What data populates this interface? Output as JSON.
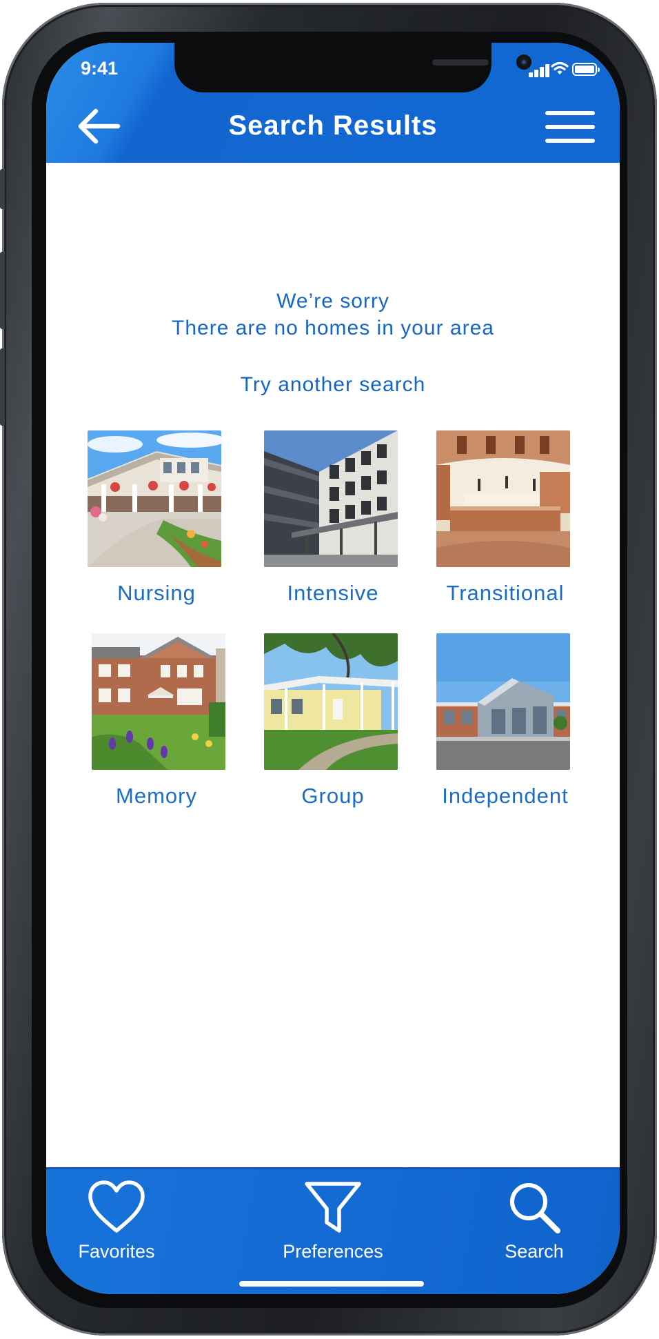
{
  "status": {
    "time": "9:41"
  },
  "header": {
    "title": "Search Results"
  },
  "message": {
    "sorry": "We’re sorry",
    "none": "There are no homes in your area",
    "try": "Try another search"
  },
  "categories": [
    {
      "label": "Nursing",
      "image": "nursing-home-photo"
    },
    {
      "label": "Intensive",
      "image": "intensive-building-photo"
    },
    {
      "label": "Transitional",
      "image": "transitional-lobby-photo"
    },
    {
      "label": "Memory",
      "image": "memory-care-home-photo"
    },
    {
      "label": "Group",
      "image": "group-home-photo"
    },
    {
      "label": "Independent",
      "image": "independent-living-photo"
    }
  ],
  "tabs": [
    {
      "label": "Favorites",
      "icon": "heart-icon"
    },
    {
      "label": "Preferences",
      "icon": "filter-icon"
    },
    {
      "label": "Search",
      "icon": "search-icon"
    }
  ],
  "colors": {
    "brand_blue": "#1269d3",
    "text_blue": "#1668c8"
  }
}
